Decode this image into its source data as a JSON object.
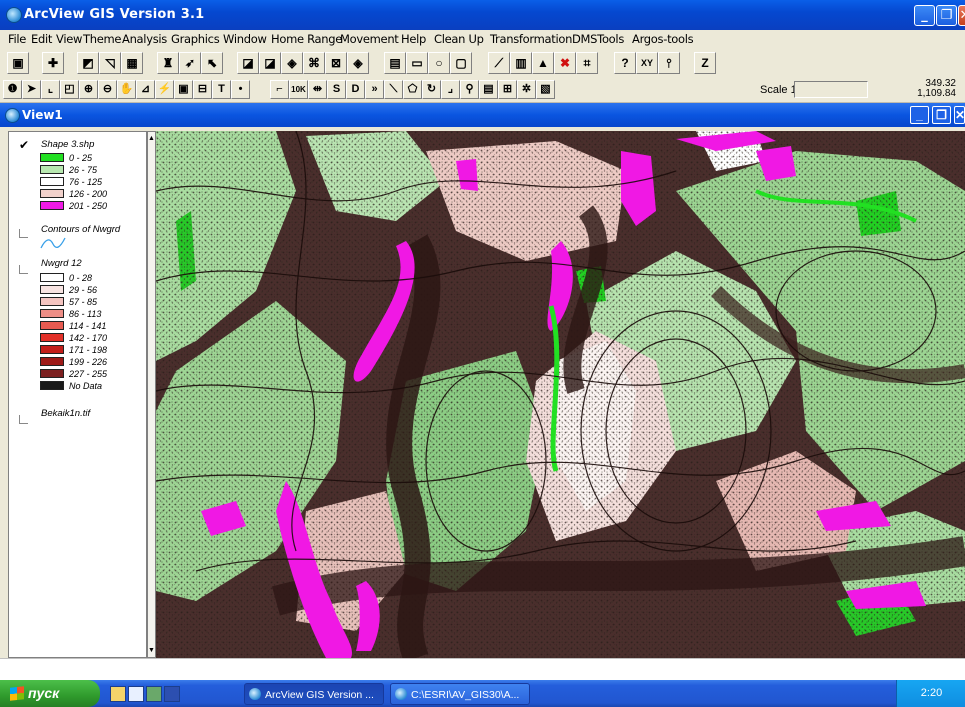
{
  "app": {
    "title": "ArcView GIS Version 3.1",
    "buttons": {
      "minimize": "_",
      "restore": "❐",
      "close": "✕"
    }
  },
  "menubar": [
    "File",
    "Edit",
    "View",
    "Theme",
    "Analysis",
    "Graphics",
    "Window",
    "Home Range",
    "Movement",
    "Help",
    "Clean Up",
    "Transformation",
    "DMSTools",
    "Argos-tools"
  ],
  "toolbar1": {
    "icons": [
      "save-icon",
      "add-theme-icon",
      "theme-properties-icon",
      "edit-legend-icon",
      "open-table-icon",
      "find-icon",
      "locate-address-icon",
      "query-builder-icon",
      "zoom-full-icon",
      "zoom-active-icon",
      "zoom-selected-icon",
      "zoom-in-icon",
      "zoom-out-icon",
      "zoom-previous-icon",
      "select-feature-icon",
      "clear-selection-icon",
      "help-icon"
    ],
    "z_label": "Z",
    "xy_label": "XY"
  },
  "toolbar2": {
    "tools": [
      "identify-icon",
      "pointer-icon",
      "vertex-edit-icon",
      "select-features-icon",
      "zoom-in-tool-icon",
      "zoom-out-tool-icon",
      "pan-icon",
      "measure-icon",
      "hot-link-icon",
      "area-of-interest-icon",
      "label-icon",
      "text-icon",
      "draw-point-icon",
      "10k-icon",
      "move-icon",
      "s-icon",
      "d-icon",
      "forward-icon",
      "line-icon",
      "polygon-icon",
      "rotate-icon",
      "snap-icon",
      "search-icon",
      "buffer-icon",
      "grid-icon",
      "shade-icon"
    ],
    "text_tool": "T",
    "tenk": "10K",
    "s": "S",
    "d": "D",
    "scale_label": "Scale 1:",
    "scale_value": "",
    "coord_x": "349.32",
    "coord_y": "1,109.84"
  },
  "view": {
    "title": "View1",
    "buttons": {
      "minimize": "_",
      "restore": "❐",
      "close": "✕"
    }
  },
  "legend": {
    "themes": [
      {
        "name": "Shape 3.shp",
        "checked": true,
        "classes": [
          {
            "label": "0 - 25",
            "color": "#22e022"
          },
          {
            "label": "26 - 75",
            "color": "#b8e8b0"
          },
          {
            "label": "76 - 125",
            "color": "#ffffff"
          },
          {
            "label": "126 - 200",
            "color": "#f2d2cc"
          },
          {
            "label": "201 - 250",
            "color": "#f01ae6"
          }
        ]
      },
      {
        "name": "Contours of Nwgrd",
        "checked": false,
        "classes": []
      },
      {
        "name": "Nwgrd 12",
        "checked": false,
        "classes": [
          {
            "label": "0 - 28",
            "color": "#ffffff"
          },
          {
            "label": "29 - 56",
            "color": "#f8e4e2"
          },
          {
            "label": "57 - 85",
            "color": "#f4c4c0"
          },
          {
            "label": "86 - 113",
            "color": "#ee8e86"
          },
          {
            "label": "114 - 141",
            "color": "#e85a50"
          },
          {
            "label": "142 - 170",
            "color": "#e23028"
          },
          {
            "label": "171 - 198",
            "color": "#c21e1a"
          },
          {
            "label": "199 - 226",
            "color": "#9e1a18"
          },
          {
            "label": "227 - 255",
            "color": "#7c2020"
          },
          {
            "label": "No Data",
            "color": "#1a1a1a"
          }
        ]
      },
      {
        "name": "Bekaik1n.tif",
        "checked": false,
        "classes": []
      }
    ]
  },
  "taskbar": {
    "start_label": "пуск",
    "tasks": [
      {
        "label": "ArcView GIS Version ...",
        "active": true
      },
      {
        "label": "C:\\ESRI\\AV_GIS30\\A...",
        "active": false
      }
    ],
    "clock": "2:20"
  }
}
